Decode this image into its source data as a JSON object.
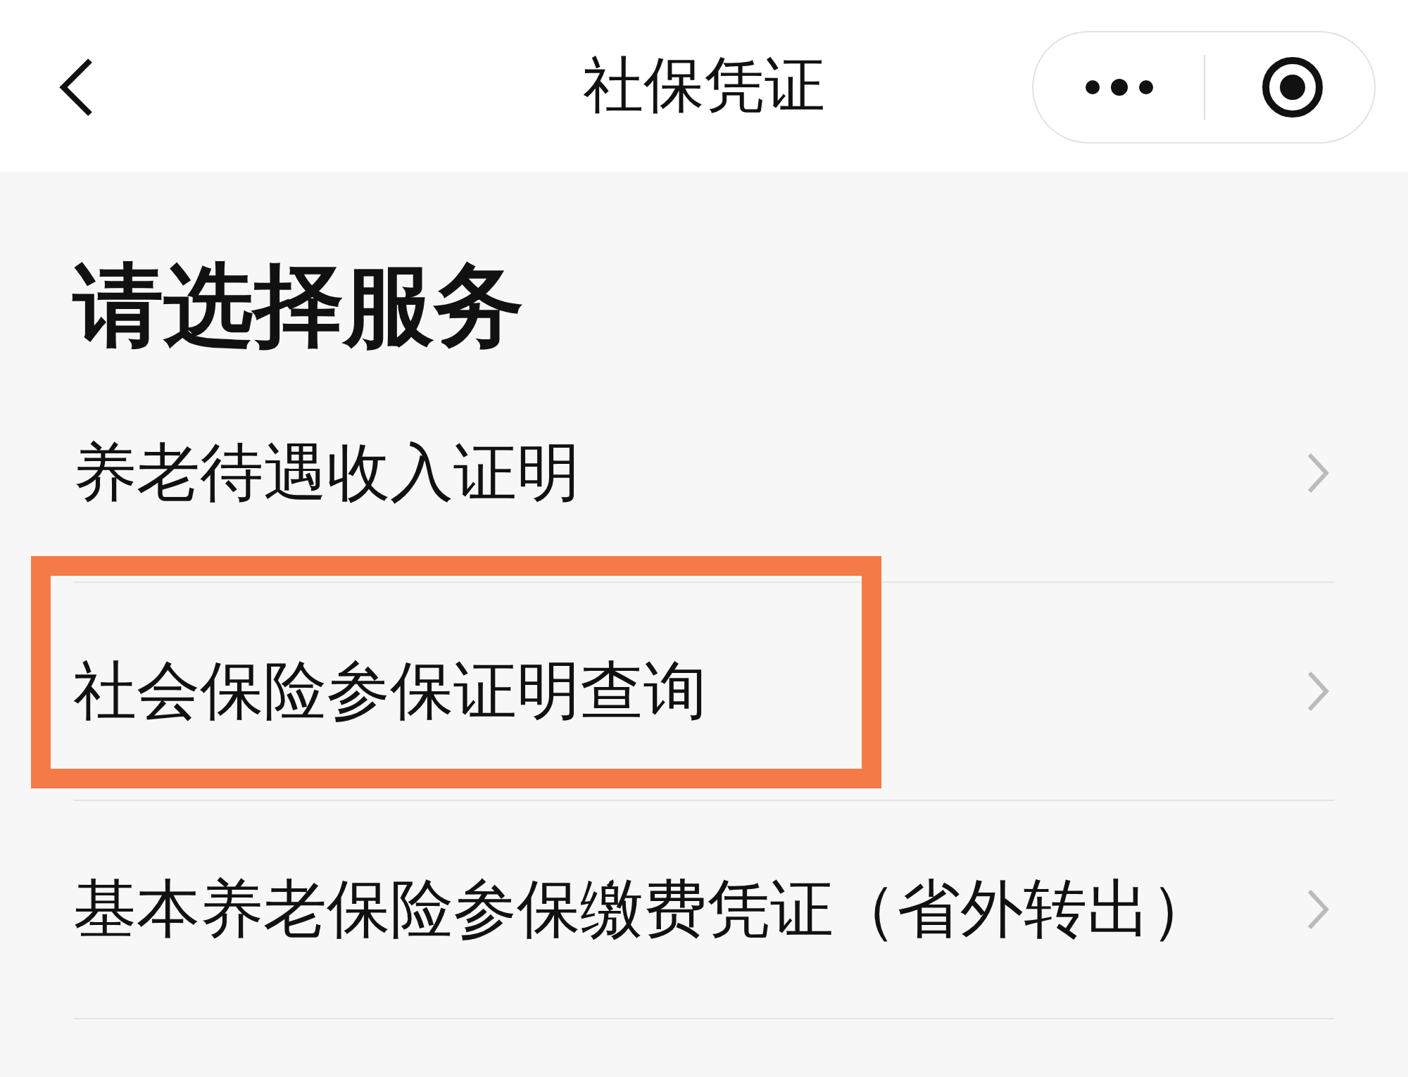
{
  "nav_bar": {
    "title": "社保凭证"
  },
  "heading": "请选择服务",
  "services": [
    {
      "label": "养老待遇收入证明",
      "highlighted": false
    },
    {
      "label": "社会保险参保证明查询",
      "highlighted": true
    },
    {
      "label": "基本养老保险参保缴费凭证（省外转出）",
      "highlighted": false
    }
  ]
}
